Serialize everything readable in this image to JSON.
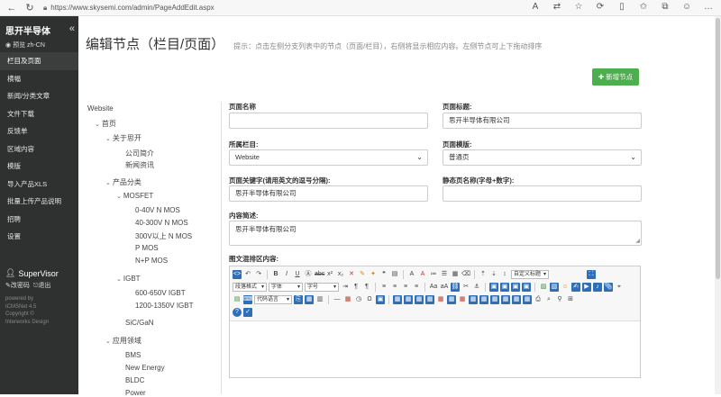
{
  "browser": {
    "url": "https://www.skysemi.com/admin/PageAddEdit.aspx"
  },
  "sidebar": {
    "brand": "思开半导体",
    "lang": "预览 zh-CN",
    "items": [
      {
        "label": "栏目及页面",
        "active": true
      },
      {
        "label": "横幅"
      },
      {
        "label": "新闻/分类文章"
      },
      {
        "label": "文件下载"
      },
      {
        "label": "反馈单"
      },
      {
        "label": "区域内容"
      },
      {
        "label": "模版"
      },
      {
        "label": "导入产品XLS"
      },
      {
        "label": "批量上传产品说明"
      },
      {
        "label": "招聘"
      },
      {
        "label": "设置"
      }
    ],
    "user": "SuperVisor",
    "change_password": "改密码",
    "logout": "退出",
    "footer": [
      "powered by",
      "ICMSNet 4.5",
      "Copyright ©",
      "Interworks Design"
    ]
  },
  "header": {
    "title": "编辑节点（栏目/页面）",
    "hint": "提示：点击左侧分支列表中的节点（页面/栏目），右侧将显示相应内容。左侧节点可上下拖动排序",
    "add_button": "新增节点"
  },
  "tree": {
    "root": "Website",
    "home": "首页",
    "about": "关于思开",
    "company_intro": "公司简介",
    "news": "新闻资讯",
    "products": "产品分类",
    "mosfet": "MOSFET",
    "mos1": "0-40V N MOS",
    "mos2": "40-300V N MOS",
    "mos3": "300V以上 N MOS",
    "mos4": "P MOS",
    "mos5": "N+P MOS",
    "igbt": "IGBT",
    "igbt1": "600-650V IGBT",
    "igbt2": "1200-1350V IGBT",
    "sic": "SiC/GaN",
    "apps": "应用领域",
    "app1": "BMS",
    "app2": "New Energy",
    "app3": "BLDC",
    "app4": "Power"
  },
  "form": {
    "page_name_label": "页面名称",
    "page_name_value": "",
    "page_title_label": "页面标题:",
    "page_title_value": "思开半导体有限公司",
    "column_label": "所属栏目:",
    "column_value": "Website",
    "template_label": "页面模版:",
    "template_value": "普通页",
    "keywords_label": "页面关键字(请用英文的逗号分隔):",
    "keywords_value": "思开半导体有限公司",
    "static_name_label": "静态页名称(字母+数字):",
    "static_name_value": "",
    "desc_label": "内容简述:",
    "desc_value": "思开半导体有限公司",
    "content_label": "图文混排区内容:"
  },
  "editor": {
    "custom_title": "自定义标题",
    "paragraph": "段落格式",
    "font": "字体",
    "size": "字号",
    "code_lang": "代码语言"
  }
}
